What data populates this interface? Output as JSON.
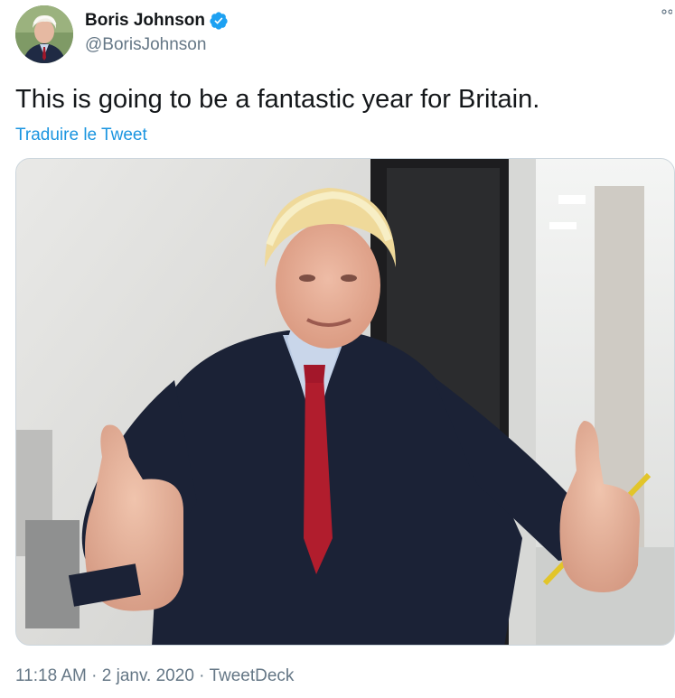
{
  "author": {
    "display_name": "Boris Johnson",
    "handle": "@BorisJohnson",
    "verified": true,
    "avatar_icon": "profile-photo"
  },
  "tweet": {
    "text": "This is going to be a fantastic year for Britain.",
    "translate_label": "Traduire le Tweet"
  },
  "meta": {
    "time": "11:18 AM",
    "separator": " · ",
    "date": "2 janv. 2020",
    "source": "TweetDeck"
  },
  "colors": {
    "link": "#1b95e0",
    "verified_badge": "#1da1f2",
    "secondary_text": "#657786",
    "primary_text": "#14171a",
    "border": "#ccd6dd"
  },
  "icons": {
    "verified": "verified-badge-icon",
    "caret": "chevron-down-icon"
  }
}
